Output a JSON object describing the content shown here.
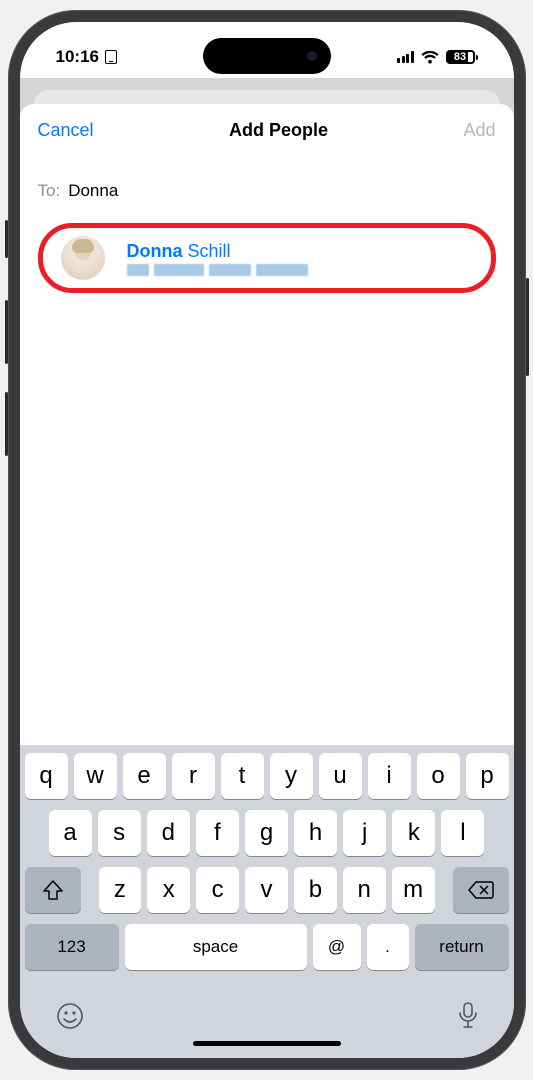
{
  "status": {
    "time": "10:16",
    "battery": "83"
  },
  "nav": {
    "cancel": "Cancel",
    "title": "Add People",
    "add": "Add"
  },
  "compose": {
    "to_label": "To:",
    "to_value": "Donna"
  },
  "suggestion": {
    "name_match": "Donna",
    "name_rest": " Schill"
  },
  "keyboard": {
    "row1": [
      "q",
      "w",
      "e",
      "r",
      "t",
      "y",
      "u",
      "i",
      "o",
      "p"
    ],
    "row2": [
      "a",
      "s",
      "d",
      "f",
      "g",
      "h",
      "j",
      "k",
      "l"
    ],
    "row3": [
      "z",
      "x",
      "c",
      "v",
      "b",
      "n",
      "m"
    ],
    "k123": "123",
    "space": "space",
    "at": "@",
    "dot": ".",
    "return": "return"
  }
}
